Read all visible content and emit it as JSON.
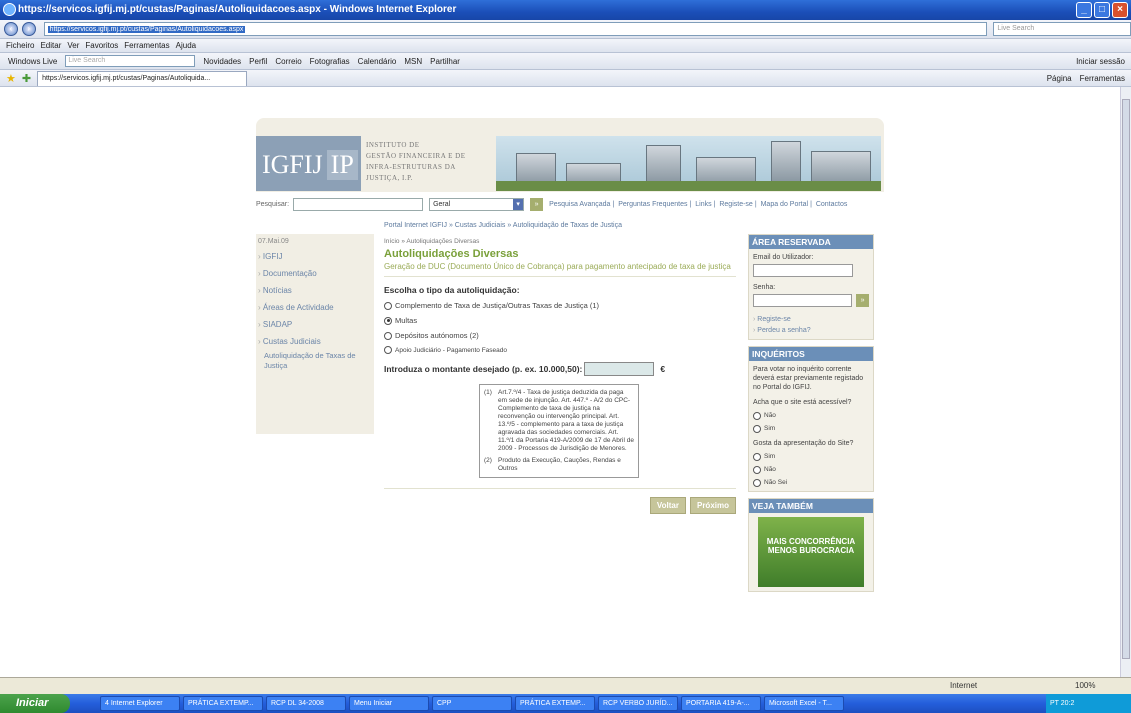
{
  "window": {
    "title": "https://servicos.igfij.mj.pt/custas/Paginas/Autoliquidacoes.aspx - Windows Internet Explorer"
  },
  "address": {
    "url": "https://servicos.igfij.mj.pt/custas/Paginas/Autoliquidacoes.aspx",
    "search_placeholder": "Live Search"
  },
  "menu": [
    "Ficheiro",
    "Editar",
    "Ver",
    "Favoritos",
    "Ferramentas",
    "Ajuda"
  ],
  "live_toolbar": {
    "brand": "Windows Live",
    "search_placeholder": "Live Search",
    "links": [
      "Novidades",
      "Perfil",
      "Correio",
      "Fotografias",
      "Calendário",
      "MSN",
      "Partilhar"
    ],
    "signin": "Iniciar sessão"
  },
  "tab": {
    "label": "https://servicos.igfij.mj.pt/custas/Paginas/Autoliquida..."
  },
  "command_bar": {
    "page": "Página",
    "tools": "Ferramentas"
  },
  "site": {
    "logo": "IGFIJ",
    "logo_ip": "IP",
    "institute": [
      "Instituto de",
      "Gestão Financeira e de",
      "Infra-Estruturas da",
      "Justiça, I.P."
    ],
    "search_label": "Pesquisar:",
    "search_select": "Geral",
    "top_links": [
      "Pesquisa Avançada",
      "Perguntas Frequentes",
      "Links",
      "Registe-se",
      "Mapa do Portal",
      "Contactos"
    ],
    "breadcrumb_top": "Portal Internet IGFIJ » Custas Judiciais » Autoliquidação de Taxas de Justiça"
  },
  "left_nav": {
    "date": "07.Mai.09",
    "items": [
      "IGFIJ",
      "Documentação",
      "Notícias",
      "Áreas de Actividade",
      "SIADAP",
      "Custas Judiciais"
    ],
    "subitem": "Autoliquidação de Taxas de Justiça"
  },
  "main": {
    "crumb": "Início » Autoliquidações Diversas",
    "title": "Autoliquidações Diversas",
    "subtitle": "Geração de DUC (Documento Único de Cobrança) para pagamento antecipado de taxa de justiça",
    "choose": "Escolha o tipo da autoliquidação:",
    "options": [
      "Complemento de Taxa de Justiça/Outras Taxas de Justiça (1)",
      "Multas",
      "Depósitos autónomos (2)",
      "Apoio Judiciário - Pagamento Faseado"
    ],
    "selected_option": "Multas",
    "amount_label": "Introduza o montante desejado (p. ex. 10.000,50):",
    "currency": "€",
    "notes": [
      {
        "key": "(1)",
        "text": "Art.7.º/4 - Taxa de justiça deduzida da paga em sede de injunção. Art. 447.º - A/2 do CPC-Complemento de taxa de justiça na reconvenção ou intervenção principal. Art. 13.º/5 - complemento para a taxa de justiça agravada das sociedades comerciais. Art. 11.º/1 da Portaria 419-A/2009 de 17 de Abril de 2009 - Processos de Jurisdição de Menores."
      },
      {
        "key": "(2)",
        "text": "Produto da Execução, Cauções, Rendas e Outros"
      }
    ],
    "back": "Voltar",
    "next": "Próximo"
  },
  "right": {
    "reserved_title": "Área Reservada",
    "email_label": "Email do Utilizador:",
    "password_label": "Senha:",
    "register": "Registe-se",
    "lost_password": "Perdeu a senha?",
    "inquiry_title": "Inquéritos",
    "inquiry_text": "Para votar no inquérito corrente deverá estar previamente registado no Portal do IGFIJ.",
    "q1": "Acha que o site está acessível?",
    "q1_options": [
      "Não",
      "Sim"
    ],
    "q2": "Gosta da apresentação do Site?",
    "q2_options": [
      "Sim",
      "Não",
      "Não Sei"
    ],
    "see_also_title": "Veja Também",
    "ad_text": "MAIS CONCORRÊNCIA MENOS BUROCRACIA"
  },
  "status": {
    "zone": "Internet",
    "zoom": "100%"
  },
  "taskbar": {
    "start": "Iniciar",
    "items": [
      "4 Internet Explorer",
      "PRÁTICA EXTEMP...",
      "RCP DL 34-2008",
      "Menu Iniciar",
      "CPP",
      "PRÁTICA EXTEMP...",
      "RCP VERBO JURÍD...",
      "PORTARIA 419-A-...",
      "Microsoft Excel - T..."
    ],
    "tray": "PT  20:2"
  }
}
